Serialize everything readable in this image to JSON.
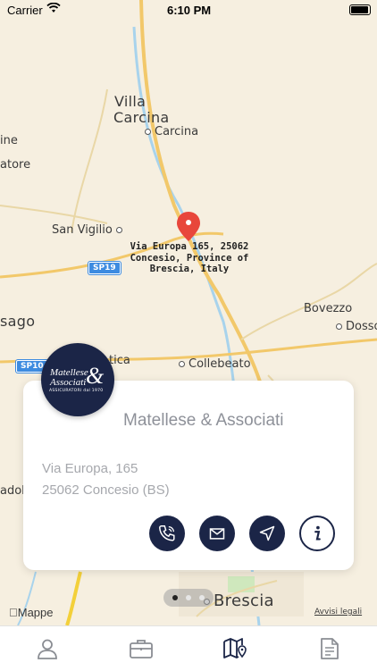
{
  "status_bar": {
    "carrier": "Carrier",
    "time": "6:10 PM"
  },
  "map": {
    "labels": {
      "villa": "Villa",
      "carcina_big": "Carcina",
      "carcina_small": "Carcina",
      "ine": "ine",
      "atore": "atore",
      "san_vigilio": "San Vigilio",
      "bovezzo": "Bovezzo",
      "dosso": "Dosso",
      "sago": "sago",
      "collebeato": "Collebeato",
      "tica": "tica",
      "brescia": "Brescia",
      "adole": "adole",
      "road_sp19": "SP19",
      "road_sp10": "SP10",
      "pin_address": "Via Europa 165, 25062 Concesio, Province of Brescia, Italy",
      "maps_logo": "Mappe",
      "legal": "Avvisi legali"
    }
  },
  "card": {
    "logo": {
      "line1": "Matellese",
      "line2": "Associati",
      "amp": "&",
      "subtitle": "ASSICURATORI dal 1970"
    },
    "name": "Matellese & Associati",
    "address_line1": "Via Europa, 165",
    "address_line2": "25062 Concesio (BS)",
    "buttons": [
      "phone",
      "email",
      "navigate",
      "info"
    ]
  },
  "pager": {
    "count": 3,
    "active": 0
  },
  "tabbar": {
    "tabs": [
      "profile",
      "briefcase",
      "map",
      "document"
    ],
    "active": 2,
    "active_color": "#1b2547",
    "inactive_color": "#8a8d93"
  },
  "colors": {
    "navy": "#1b2547",
    "pin_red": "#e8463b",
    "shield_blue": "#3d8be0"
  }
}
